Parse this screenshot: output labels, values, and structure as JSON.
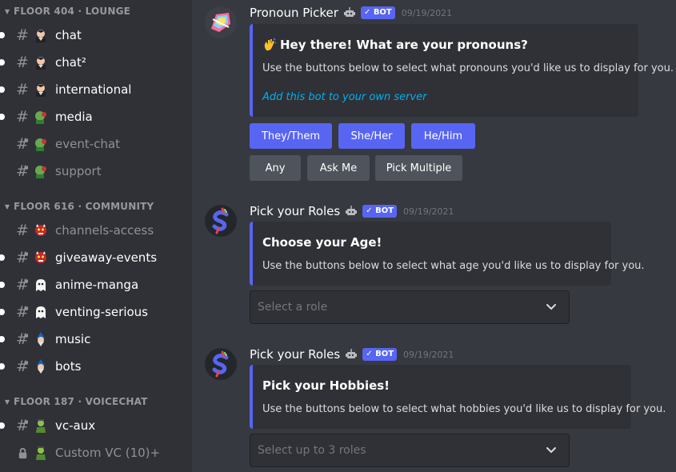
{
  "sidebar": {
    "categories": [
      {
        "label": "FLOOR 404 · LOUNGE",
        "channels": [
          {
            "name": "chat",
            "unread": true,
            "emoji": "vampire-icon"
          },
          {
            "name": "chat²",
            "unread": true,
            "emoji": "vampire-icon"
          },
          {
            "name": "international",
            "unread": true,
            "emoji": "vampire-icon"
          },
          {
            "name": "media",
            "unread": true,
            "emoji": "zombie-icon"
          },
          {
            "name": "event-chat",
            "unread": false,
            "emoji": "zombie-icon"
          },
          {
            "name": "support",
            "unread": false,
            "emoji": "zombie-icon"
          }
        ]
      },
      {
        "label": "FLOOR 616 · COMMUNITY",
        "channels": [
          {
            "name": "channels-access",
            "unread": false,
            "emoji": "ogre-icon"
          },
          {
            "name": "giveaway-events",
            "unread": true,
            "emoji": "ogre-icon"
          },
          {
            "name": "anime-manga",
            "unread": true,
            "emoji": "ghost-icon"
          },
          {
            "name": "venting-serious",
            "unread": true,
            "emoji": "ghost-icon"
          },
          {
            "name": "music",
            "unread": true,
            "emoji": "mage-icon"
          },
          {
            "name": "bots",
            "unread": true,
            "emoji": "mage-icon"
          }
        ]
      },
      {
        "label": "FLOOR 187 · VOICECHAT",
        "channels": [
          {
            "name": "vc-aux",
            "unread": true,
            "emoji": "genie-icon"
          },
          {
            "name": "Custom VC (10)+",
            "unread": false,
            "emoji": "genie-icon"
          }
        ]
      }
    ]
  },
  "messages": [
    {
      "author": "Pronoun Picker",
      "bot_tag": "✓ BOT",
      "timestamp": "09/19/2021",
      "embed": {
        "title": "Hey there! What are your pronouns?",
        "description": "Use the buttons below to select what pronouns you'd like us to display for you.",
        "link": "Add this bot to your own server"
      },
      "buttons_row1": [
        "They/Them",
        "She/Her",
        "He/Him"
      ],
      "buttons_row2": [
        "Any",
        "Ask Me",
        "Pick Multiple"
      ]
    },
    {
      "author": "Pick your Roles",
      "bot_tag": "✓ BOT",
      "timestamp": "09/19/2021",
      "embed": {
        "title": "Choose your Age!",
        "description": "Use the buttons below to select what age you'd like us to display for you."
      },
      "select_placeholder": "Select a role"
    },
    {
      "author": "Pick your Roles",
      "bot_tag": "✓ BOT",
      "timestamp": "09/19/2021",
      "embed": {
        "title": "Pick your Hobbies!",
        "description": "Use the buttons below to select what hobbies you'd like us to display for you."
      },
      "select_placeholder": "Select up to 3 roles"
    }
  ],
  "colors": {
    "blurple": "#5865f2",
    "secondary_button": "#4f545c",
    "link": "#00aff4",
    "sidebar_bg": "#2f3136",
    "chat_bg": "#36393f"
  }
}
